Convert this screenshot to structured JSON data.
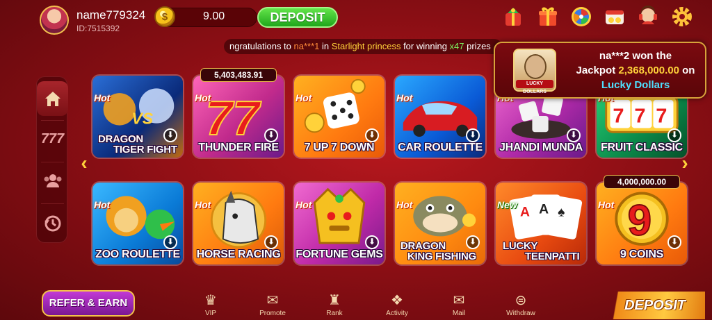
{
  "user": {
    "name": "name779324",
    "id": "ID:7515392",
    "balance": "9.00"
  },
  "top": {
    "deposit_label": "DEPOSIT",
    "icons": [
      "gift-bag-icon",
      "gift-box-icon",
      "lucky-wheel-icon",
      "bonus-icon",
      "support-agent-icon",
      "settings-gear-icon"
    ]
  },
  "marquee": {
    "prefix": "ngratulations to ",
    "user": "na***1",
    "mid": " in ",
    "game": "Starlight princess",
    "mid2": " for winning ",
    "multiplier": "x47",
    "suffix": " prizes"
  },
  "jackpot_popup": {
    "user_line": "na***2 won the",
    "jackpot_prefix": "Jackpot ",
    "amount": "2,368,000.00",
    "jackpot_suffix": " on",
    "game": "Lucky Dollars",
    "thumb_label": "LUCKY DOLLARS"
  },
  "sidebar": {
    "items": [
      "home-icon",
      "slots-777-icon",
      "multiplayer-icon",
      "history-icon"
    ]
  },
  "games": [
    {
      "title_line1": "DRAGON",
      "title_line2": "TIGER FIGHT",
      "badge": "Hot",
      "jackpot": ""
    },
    {
      "title_line1": "THUNDER FIRE",
      "title_line2": "",
      "badge": "Hot",
      "jackpot": "5,403,483.91"
    },
    {
      "title_line1": "7 UP 7 DOWN",
      "title_line2": "",
      "badge": "Hot",
      "jackpot": ""
    },
    {
      "title_line1": "CAR ROULETTE",
      "title_line2": "",
      "badge": "Hot",
      "jackpot": ""
    },
    {
      "title_line1": "JHANDI MUNDA",
      "title_line2": "",
      "badge": "Hot",
      "jackpot": ""
    },
    {
      "title_line1": "FRUIT CLASSIC",
      "title_line2": "",
      "badge": "Hot",
      "jackpot": ""
    },
    {
      "title_line1": "ZOO ROULETTE",
      "title_line2": "",
      "badge": "Hot",
      "jackpot": ""
    },
    {
      "title_line1": "HORSE RACING",
      "title_line2": "",
      "badge": "Hot",
      "jackpot": ""
    },
    {
      "title_line1": "FORTUNE GEMS",
      "title_line2": "",
      "badge": "Hot",
      "jackpot": ""
    },
    {
      "title_line1": "DRAGON",
      "title_line2": "KING FISHING",
      "badge": "Hot",
      "jackpot": ""
    },
    {
      "title_line1": "LUCKY",
      "title_line2": "TEENPATTI",
      "badge": "New",
      "jackpot": ""
    },
    {
      "title_line1": "9 COINS",
      "title_line2": "",
      "badge": "Hot",
      "jackpot": "4,000,000.00"
    }
  ],
  "bottom": {
    "refer_label": "REFER & EARN",
    "nav": [
      {
        "label": "VIP",
        "icon": "vip-crown-icon"
      },
      {
        "label": "Promote",
        "icon": "promote-icon"
      },
      {
        "label": "Rank",
        "icon": "rank-trophy-icon"
      },
      {
        "label": "Activity",
        "icon": "activity-gift-icon"
      },
      {
        "label": "Mail",
        "icon": "mail-icon"
      },
      {
        "label": "Withdraw",
        "icon": "withdraw-icon"
      }
    ],
    "deposit_label": "DEPOSIT"
  },
  "colors": {
    "background": "#8f0f15",
    "accent_gold": "#ffd23a",
    "deposit_green": "#1fa71b",
    "jackpot_cyan": "#4ee0ff"
  }
}
